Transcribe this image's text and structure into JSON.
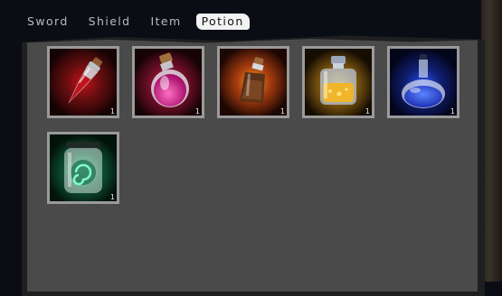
{
  "tabs": [
    {
      "label": "Sword",
      "active": false
    },
    {
      "label": "Shield",
      "active": false
    },
    {
      "label": "Item",
      "active": false
    },
    {
      "label": "Potion",
      "active": true
    }
  ],
  "inventory": {
    "slots": [
      {
        "icon": "red-vial-icon",
        "quantity": "1",
        "glow": "#b3141a"
      },
      {
        "icon": "pink-round-flask-icon",
        "quantity": "1",
        "glow": "#c8195c"
      },
      {
        "icon": "brown-bottle-icon",
        "quantity": "1",
        "glow": "#d9651a"
      },
      {
        "icon": "yellow-square-jar-icon",
        "quantity": "1",
        "glow": "#c9a21d"
      },
      {
        "icon": "blue-flask-icon",
        "quantity": "1",
        "glow": "#1c3fc4"
      },
      {
        "icon": "green-swirl-jar-icon",
        "quantity": "1",
        "glow": "#1f9a63"
      }
    ]
  }
}
